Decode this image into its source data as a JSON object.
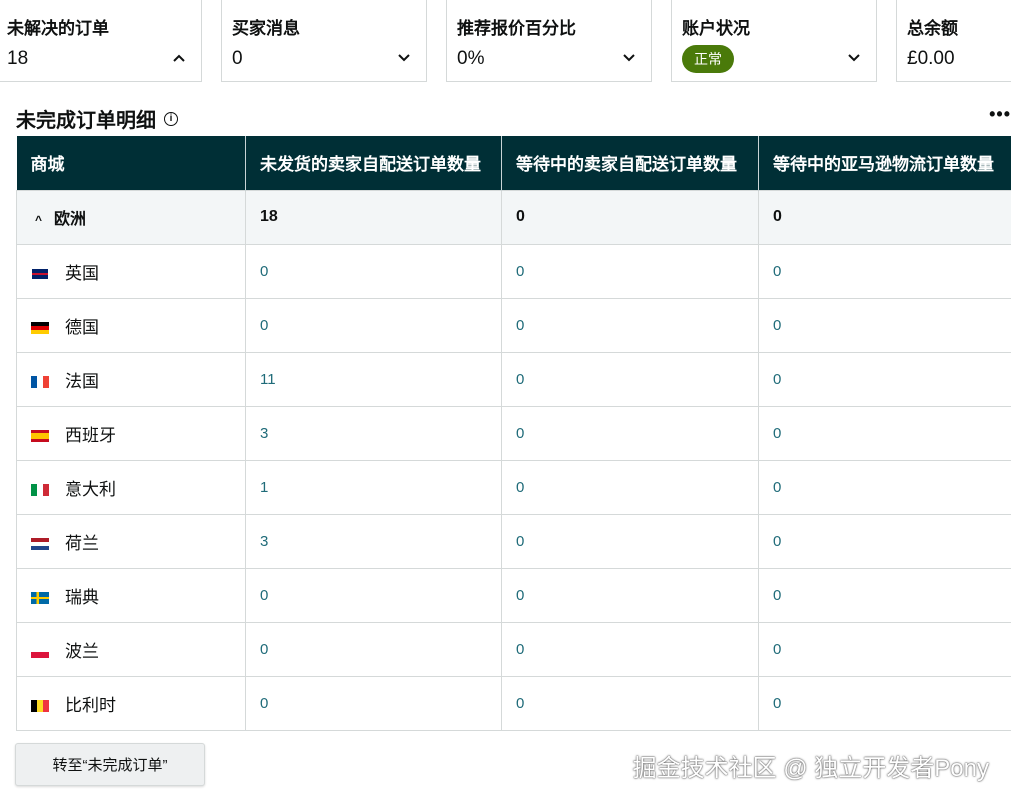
{
  "cards": [
    {
      "title": "未解决的订单",
      "value": "18",
      "icon": "chevron-up-icon"
    },
    {
      "title": "买家消息",
      "value": "0",
      "icon": "chevron-down-icon"
    },
    {
      "title": "推荐报价百分比",
      "value": "0%",
      "icon": "chevron-down-icon"
    },
    {
      "title": "账户状况",
      "badge": "正常",
      "icon": "chevron-down-icon"
    },
    {
      "title": "总余额",
      "value": "£0.00"
    }
  ],
  "section": {
    "title": "未完成订单明细",
    "more": "•••"
  },
  "table": {
    "headers": [
      "商城",
      "未发货的卖家自配送订单数量",
      "等待中的卖家自配送订单数量",
      "等待中的亚马逊物流订单数量"
    ],
    "group": {
      "name": "欧洲",
      "values": [
        "18",
        "0",
        "0"
      ]
    },
    "rows": [
      {
        "name": "英国",
        "flag": "uk",
        "values": [
          "0",
          "0",
          "0"
        ]
      },
      {
        "name": "德国",
        "flag": "de",
        "values": [
          "0",
          "0",
          "0"
        ]
      },
      {
        "name": "法国",
        "flag": "fr",
        "values": [
          "11",
          "0",
          "0"
        ]
      },
      {
        "name": "西班牙",
        "flag": "es",
        "values": [
          "3",
          "0",
          "0"
        ]
      },
      {
        "name": "意大利",
        "flag": "it",
        "values": [
          "1",
          "0",
          "0"
        ]
      },
      {
        "name": "荷兰",
        "flag": "nl",
        "values": [
          "3",
          "0",
          "0"
        ]
      },
      {
        "name": "瑞典",
        "flag": "se",
        "values": [
          "0",
          "0",
          "0"
        ]
      },
      {
        "name": "波兰",
        "flag": "pl",
        "values": [
          "0",
          "0",
          "0"
        ]
      },
      {
        "name": "比利时",
        "flag": "be",
        "values": [
          "0",
          "0",
          "0"
        ]
      }
    ]
  },
  "button": "转至“未完成订单”",
  "watermark": "掘金技术社区 @ 独立开发者Pony",
  "colors": {
    "header": "#002f36",
    "badge": "#4a7a0a",
    "link": "#1f6b79"
  }
}
